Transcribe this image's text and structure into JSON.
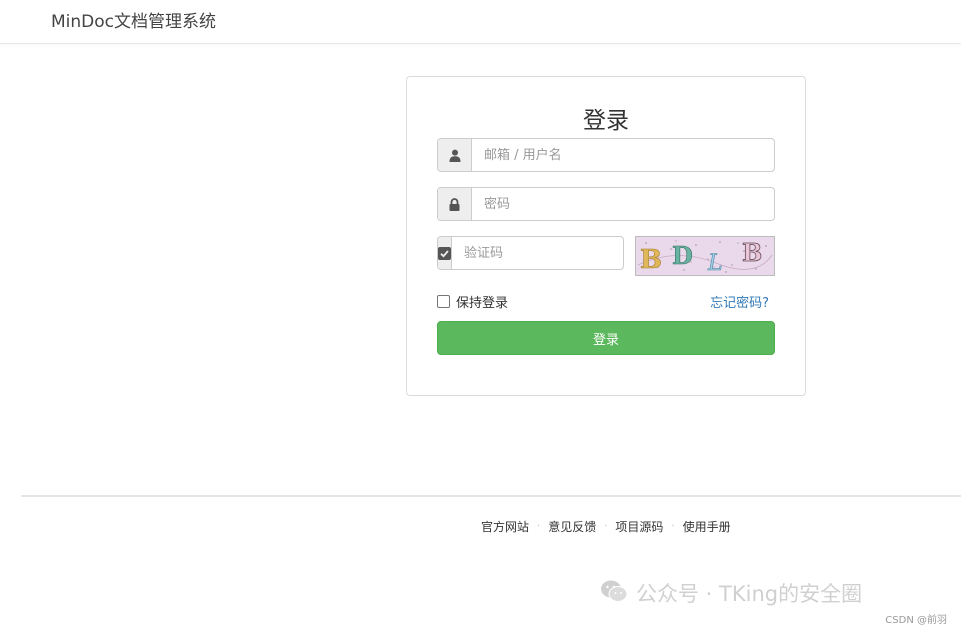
{
  "navbar": {
    "brand": "MinDoc文档管理系统"
  },
  "login": {
    "title": "登录",
    "username_placeholder": "邮箱 / 用户名",
    "password_placeholder": "密码",
    "captcha_placeholder": "验证码",
    "captcha_text": "BDLB",
    "remember_label": "保持登录",
    "forgot_label": "忘记密码?",
    "submit_label": "登录"
  },
  "footer": {
    "links": [
      "官方网站",
      "意见反馈",
      "项目源码",
      "使用手册"
    ],
    "separator": "·"
  },
  "watermark": {
    "text": "公众号 · TKing的安全圈"
  },
  "credit": {
    "text": "CSDN @前羽"
  },
  "colors": {
    "primary_btn": "#5cb85c",
    "link": "#337ab7",
    "addon_bg": "#eeeeee"
  },
  "icons": {
    "username": "user-icon",
    "password": "lock-icon",
    "captcha": "check-square-icon"
  }
}
